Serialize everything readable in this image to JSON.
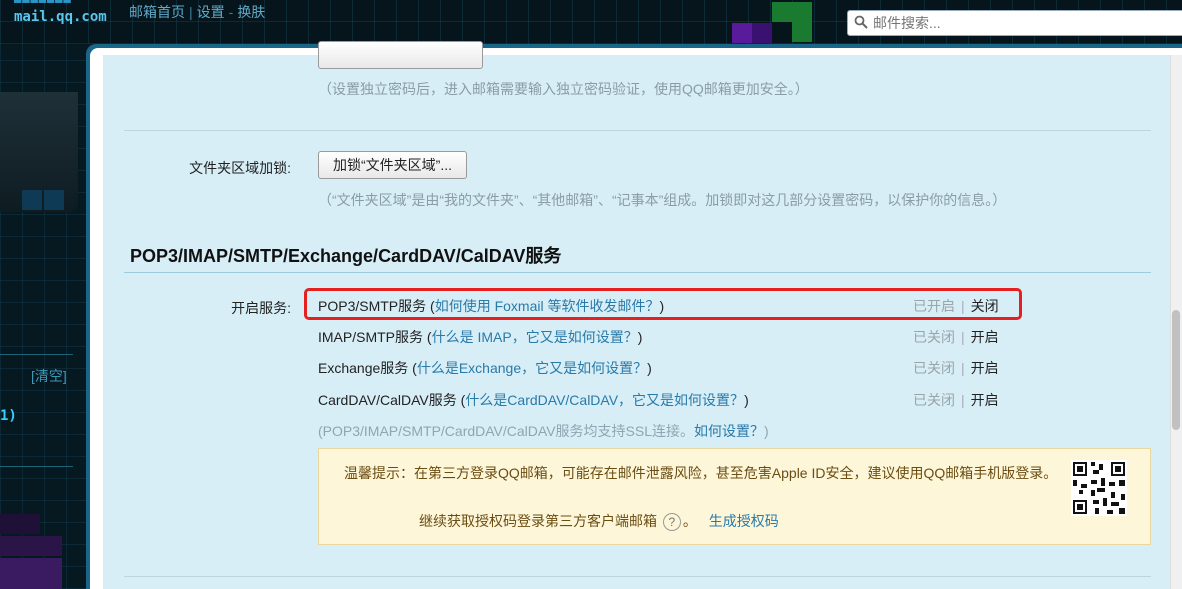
{
  "header": {
    "logo_text": "mail.qq.com",
    "links": [
      "邮箱首页",
      "设置",
      "换肤"
    ],
    "search_placeholder": "邮件搜索..."
  },
  "sidebar": {
    "clear_label": "[清空]",
    "count_text": "1)"
  },
  "settings": {
    "password_hint": "（设置独立密码后，进入邮箱需要输入独立密码验证，使用QQ邮箱更加安全。）",
    "folder_lock_label": "文件夹区域加锁:",
    "folder_lock_button": "加锁“文件夹区域”...",
    "folder_lock_hint": "（“文件夹区域”是由“我的文件夹”、“其他邮箱”、“记事本”组成。加锁即对这几部分设置密码，以保护你的信息。）"
  },
  "services_section": {
    "title": "POP3/IMAP/SMTP/Exchange/CardDAV/CalDAV服务",
    "enable_label": "开启服务:",
    "services": [
      {
        "name": "POP3/SMTP服务",
        "help_link": "如何使用 Foxmail 等软件收发邮件？",
        "status": "已开启",
        "action": "关闭"
      },
      {
        "name": "IMAP/SMTP服务",
        "help_link": "什么是 IMAP，它又是如何设置？",
        "status": "已关闭",
        "action": "开启"
      },
      {
        "name": "Exchange服务",
        "help_link": "什么是Exchange，它又是如何设置？",
        "status": "已关闭",
        "action": "开启"
      },
      {
        "name": "CardDAV/CalDAV服务",
        "help_link": "什么是CardDAV/CalDAV，它又是如何设置？",
        "status": "已关闭",
        "action": "开启"
      }
    ],
    "ssl_note": "(POP3/IMAP/SMTP/CardDAV/CalDAV服务均支持SSL连接。",
    "ssl_link": "如何设置？",
    "ssl_close": ")"
  },
  "notice": {
    "message": "温馨提示：在第三方登录QQ邮箱，可能存在邮件泄露风险，甚至危害Apple ID安全，建议使用QQ邮箱手机版登录。",
    "continue_text": "继续获取授权码登录第三方客户端邮箱",
    "help_glyph": "?",
    "period": "。",
    "generate_link": "生成授权码"
  },
  "colors": {
    "content_bg": "#d7eef7",
    "link": "#2a7aa8",
    "highlight_border": "#e62020",
    "notice_bg": "#fdf6d9"
  }
}
